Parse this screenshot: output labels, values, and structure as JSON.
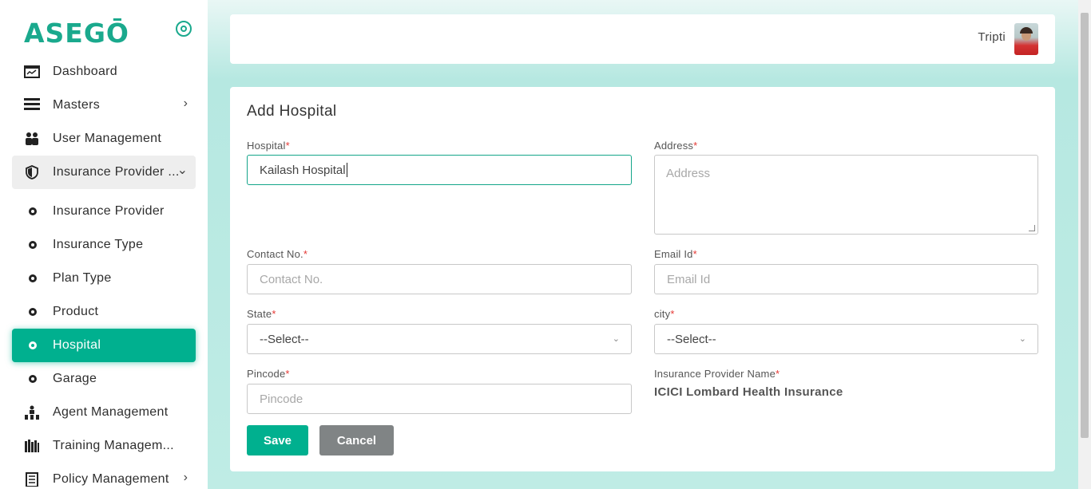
{
  "brand": {
    "logo_text": "ASEGŌ",
    "accent": "#00b08f"
  },
  "sidebar": {
    "items": [
      {
        "label": "Dashboard",
        "icon": "dashboard-icon"
      },
      {
        "label": "Masters",
        "icon": "list-icon",
        "chevron": "›"
      },
      {
        "label": "User Management",
        "icon": "users-icon"
      },
      {
        "label": "Insurance Provider ...",
        "icon": "shield-icon",
        "chevron": "⌄"
      },
      {
        "label": "Insurance Provider"
      },
      {
        "label": "Insurance Type"
      },
      {
        "label": "Plan Type"
      },
      {
        "label": "Product"
      },
      {
        "label": "Hospital",
        "active": true
      },
      {
        "label": "Garage"
      },
      {
        "label": "Agent Management",
        "icon": "agent-icon"
      },
      {
        "label": "Training Managem...",
        "icon": "books-icon"
      },
      {
        "label": "Policy Management",
        "icon": "policy-icon",
        "chevron": "›"
      }
    ]
  },
  "header": {
    "user_name": "Tripti"
  },
  "form": {
    "title": "Add Hospital",
    "required_mark": "*",
    "hospital": {
      "label": "Hospital",
      "value": "Kailash Hospital"
    },
    "address": {
      "label": "Address",
      "placeholder": "Address"
    },
    "contact": {
      "label": "Contact No.",
      "placeholder": "Contact No."
    },
    "email": {
      "label": "Email Id",
      "placeholder": "Email Id"
    },
    "state": {
      "label": "State",
      "selected": "--Select--"
    },
    "city": {
      "label": "city",
      "selected": "--Select--"
    },
    "pincode": {
      "label": "Pincode",
      "placeholder": "Pincode"
    },
    "insurance_provider": {
      "label": "Insurance Provider Name",
      "value": "ICICI Lombard Health Insurance"
    },
    "save_label": "Save",
    "cancel_label": "Cancel"
  }
}
